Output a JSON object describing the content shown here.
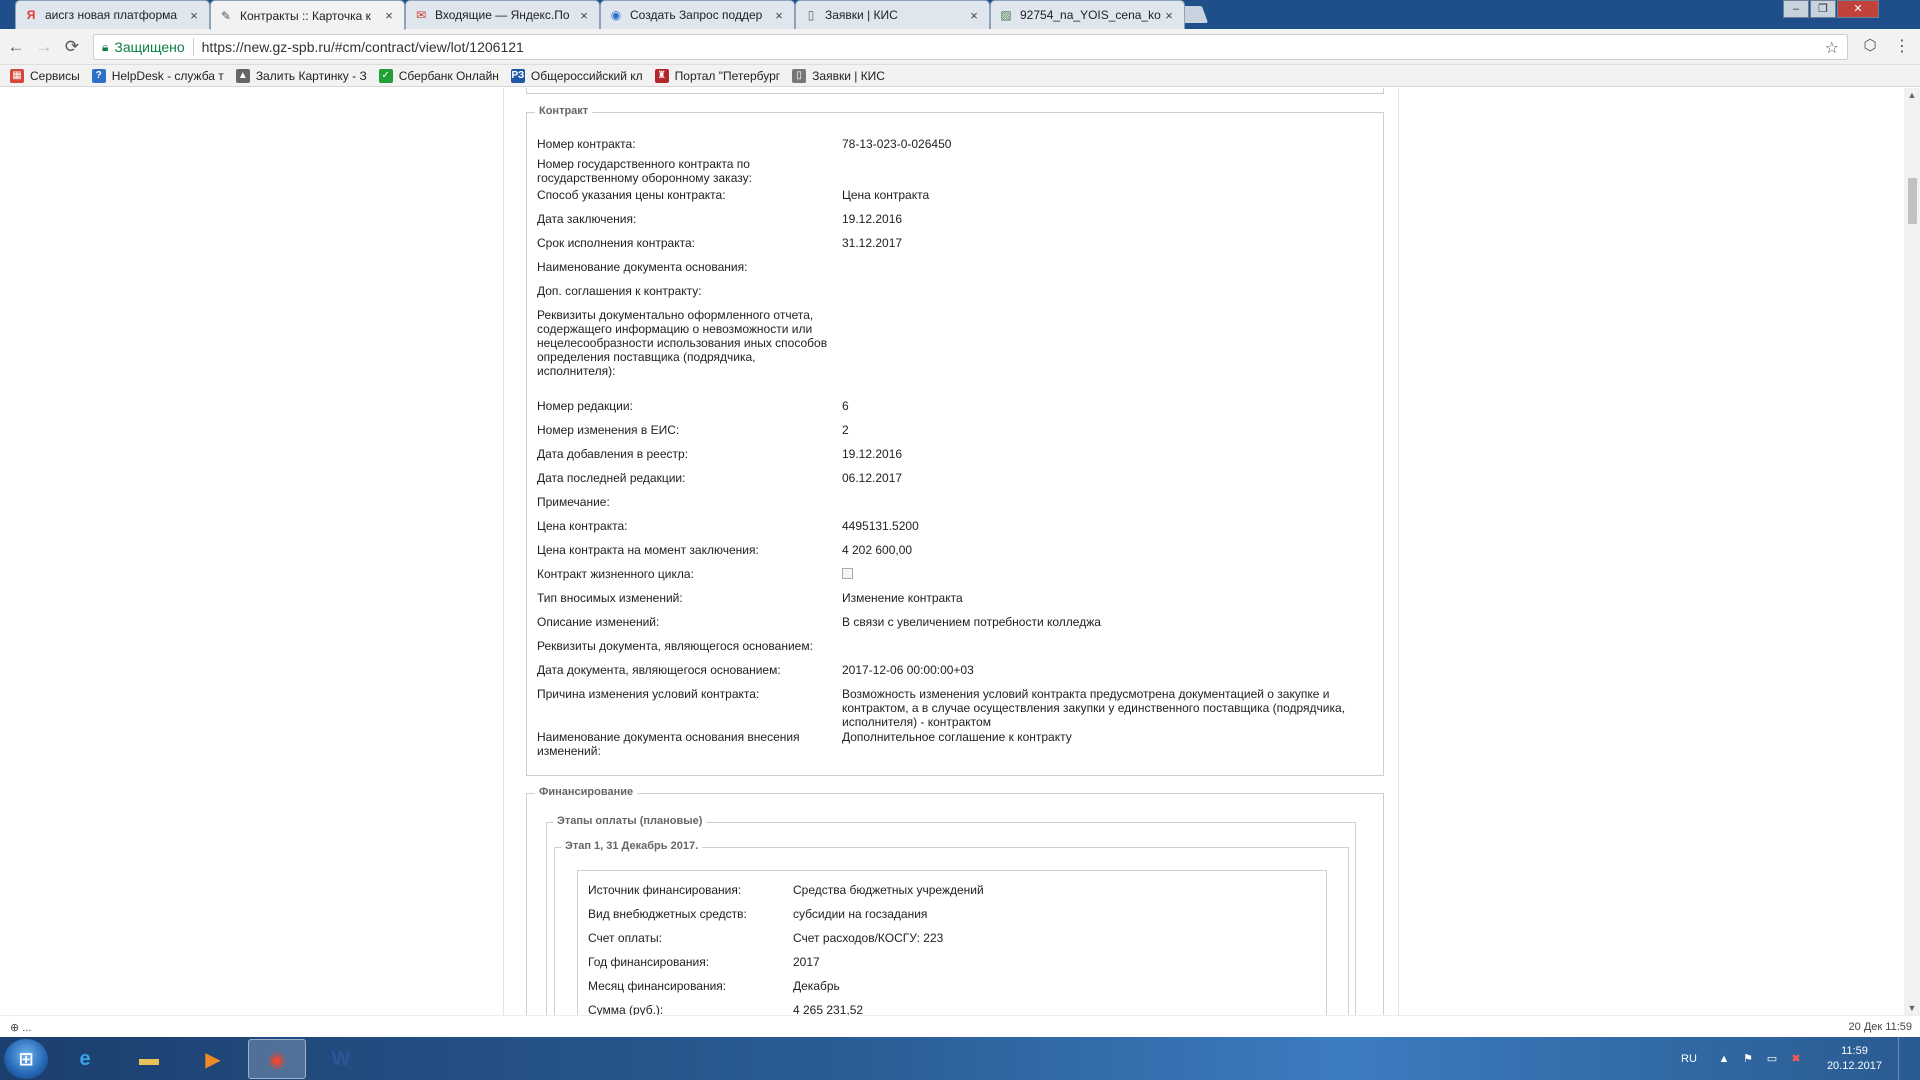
{
  "tabs": [
    {
      "label": "аисгз новая платформа",
      "icon": "yandex-icon",
      "icon_text": "Я",
      "icon_color": "#e53935"
    },
    {
      "label": "Контракты :: Карточка к",
      "icon": "tools-icon",
      "icon_text": "✎",
      "icon_color": "#555555"
    },
    {
      "label": "Входящие — Яндекс.По",
      "icon": "mail-icon",
      "icon_text": "✉",
      "icon_color": "#d23b2e"
    },
    {
      "label": "Создать Запрос поддер",
      "icon": "globe-icon",
      "icon_text": "◉",
      "icon_color": "#2f6fc8"
    },
    {
      "label": "Заявки | КИС",
      "icon": "page-icon",
      "icon_text": "▯",
      "icon_color": "#666666"
    },
    {
      "label": "92754_na_YOIS_cena_ko",
      "icon": "image-icon",
      "icon_text": "▨",
      "icon_color": "#4a7a4a"
    }
  ],
  "active_tab_index": 1,
  "tab_close_glyph": "×",
  "window_controls": {
    "minimize": "–",
    "maximize": "❐",
    "close": "✕"
  },
  "address": {
    "secure_label": "Защищено",
    "url": "https://new.gz-spb.ru/#cm/contract/view/lot/1206121",
    "back": "←",
    "forward": "→",
    "reload": "⟳",
    "star": "☆"
  },
  "bookmarks": [
    {
      "label": "Сервисы",
      "icon": "apps-grid-icon",
      "icon_text": "▦",
      "color": "#d44638"
    },
    {
      "label": "HelpDesk - служба т",
      "icon": "helpdesk-icon",
      "icon_text": "?",
      "color": "#2f6fc8"
    },
    {
      "label": "Залить Картинку - З",
      "icon": "upload-icon",
      "icon_text": "▲",
      "color": "#666666"
    },
    {
      "label": "Сбербанк Онлайн",
      "icon": "sberbank-icon",
      "icon_text": "✓",
      "color": "#21a038"
    },
    {
      "label": "Общероссийский кл",
      "icon": "classifier-icon",
      "icon_text": "РЗ",
      "color": "#1f56a6"
    },
    {
      "label": "Портал \"Петербург",
      "icon": "coat-of-arms-icon",
      "icon_text": "♜",
      "color": "#b3262b"
    },
    {
      "label": "Заявки | КИС",
      "icon": "page-icon",
      "icon_text": "▯",
      "color": "#777777"
    }
  ],
  "contract_section": {
    "legend": "Контракт",
    "rows": [
      {
        "label": "Номер контракта:",
        "value": "78-13-023-0-026450"
      },
      {
        "label": "Номер государственного контракта по государственному оборонному заказу:",
        "value": ""
      },
      {
        "label": "Способ указания цены контракта:",
        "value": "Цена контракта"
      },
      {
        "label": "Дата заключения:",
        "value": "19.12.2016"
      },
      {
        "label": "Срок исполнения контракта:",
        "value": "31.12.2017"
      },
      {
        "label": "Наименование документа основания:",
        "value": ""
      },
      {
        "label": "Доп. соглашения к контракту:",
        "value": ""
      },
      {
        "label": "Реквизиты документально оформленного отчета, содержащего информацию о невозможности или нецелесообразности использования иных способов определения поставщика (подрядчика, исполнителя):",
        "value": ""
      },
      {
        "label": "Номер редакции:",
        "value": "6"
      },
      {
        "label": "Номер изменения в ЕИС:",
        "value": "2"
      },
      {
        "label": "Дата добавления в реестр:",
        "value": "19.12.2016"
      },
      {
        "label": "Дата последней редакции:",
        "value": "06.12.2017"
      },
      {
        "label": "Примечание:",
        "value": ""
      },
      {
        "label": "Цена контракта:",
        "value": "4495131.5200"
      },
      {
        "label": "Цена контракта на момент заключения:",
        "value": "4 202 600,00"
      },
      {
        "label": "Контракт жизненного цикла:",
        "value": "",
        "checkbox": true,
        "checked": false
      },
      {
        "label": "Тип вносимых изменений:",
        "value": "Изменение контракта"
      },
      {
        "label": "Описание изменений:",
        "value": "В связи с увеличением потребности колледжа"
      },
      {
        "label": "Реквизиты документа, являющегося основанием:",
        "value": ""
      },
      {
        "label": "Дата документа, являющегося основанием:",
        "value": "2017-12-06 00:00:00+03"
      },
      {
        "label": "Причина изменения условий контракта:",
        "value": "Возможность изменения условий контракта предусмотрена документацией о закупке и контрактом, а в случае осуществления закупки у единственного поставщика (подрядчика, исполнителя) - контрактом"
      },
      {
        "label": "Наименование документа основания внесения изменений:",
        "value": "Дополнительное соглашение к контракту"
      }
    ]
  },
  "financing_section": {
    "legend": "Финансирование",
    "stages_legend": "Этапы оплаты (плановые)",
    "stage_legend": "Этап 1, 31 Декабрь 2017.",
    "rows": [
      {
        "label": "Источник финансирования:",
        "value": "Средства бюджетных учреждений"
      },
      {
        "label": "Вид внебюджетных средств:",
        "value": "субсидии на госзадания"
      },
      {
        "label": "Счет оплаты:",
        "value": "Счет расходов/КОСГУ: 223"
      },
      {
        "label": "Год финансирования:",
        "value": "2017"
      },
      {
        "label": "Месяц финансирования:",
        "value": "Декабрь"
      },
      {
        "label": "Сумма (руб.):",
        "value": "4 265 231,52"
      }
    ]
  },
  "status": {
    "left": "⊕ ...",
    "right": "20 Дек 11:59"
  },
  "taskbar": {
    "start_glyph": "⊞",
    "apps": [
      {
        "name": "ie-icon",
        "glyph": "e",
        "color": "#3aa0e8"
      },
      {
        "name": "explorer-folder-icon",
        "glyph": "▬",
        "color": "#e8c35a"
      },
      {
        "name": "media-player-icon",
        "glyph": "▶",
        "color": "#f08a24"
      },
      {
        "name": "chrome-icon",
        "glyph": "◉",
        "color": "#e04a3a"
      },
      {
        "name": "word-icon",
        "glyph": "W",
        "color": "#2b5797"
      }
    ],
    "active_app_index": 3,
    "lang": "RU",
    "tray_arrow": "▲",
    "flag": "⚑",
    "network": "▭",
    "volume": "✖",
    "time": "11:59",
    "date": "20.12.2017"
  }
}
